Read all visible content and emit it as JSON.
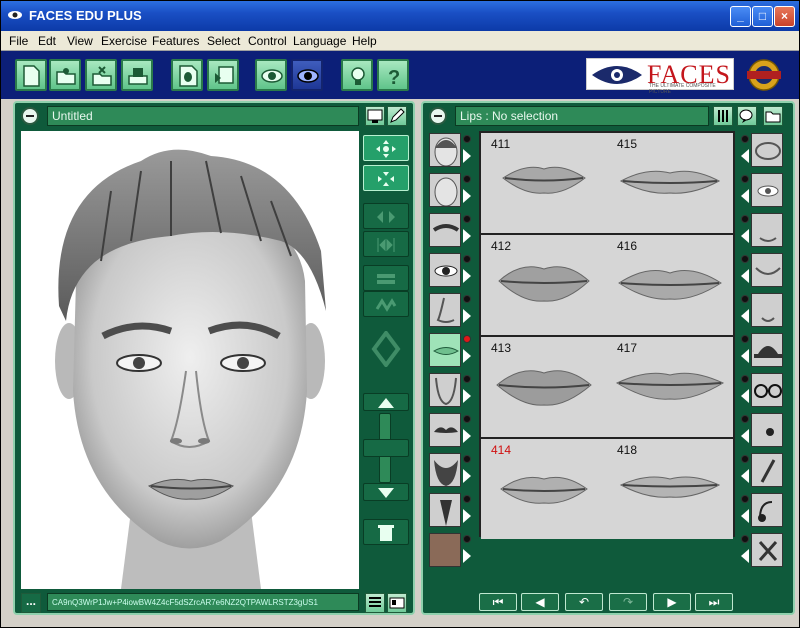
{
  "window": {
    "title": "FACES EDU PLUS",
    "controls": {
      "minimize": "_",
      "maximize": "□",
      "close": "×"
    }
  },
  "menu": [
    "File",
    "Edt",
    "View",
    "Exercise",
    "Features",
    "Select",
    "Control",
    "Language",
    "Help"
  ],
  "toolbar": {
    "buttons": [
      "new-document-icon",
      "open-folder-icon",
      "save-folder-icon",
      "print-icon",
      "face-export-icon",
      "slideshow-icon",
      "eye-icon",
      "dark-eye-icon",
      "hint-bulb-icon",
      "help-icon"
    ]
  },
  "logo": {
    "text": "FACES",
    "tagline": "THE ULTIMATE COMPOSITE PICTURE"
  },
  "left_panel": {
    "title": "Untitled",
    "code": "CA9nQ3WrP1Jw+P4iowBW4Z4cF5dSZrcAR7e6NZ2QTPAWLRSTZ3gUS1",
    "more_label": "..."
  },
  "right_panel": {
    "title": "Lips : No selection",
    "cells": [
      {
        "id": "411",
        "selected": false
      },
      {
        "id": "415",
        "selected": false
      },
      {
        "id": "412",
        "selected": false
      },
      {
        "id": "416",
        "selected": false
      },
      {
        "id": "413",
        "selected": false
      },
      {
        "id": "417",
        "selected": false
      },
      {
        "id": "414",
        "selected": true
      },
      {
        "id": "418",
        "selected": false
      }
    ],
    "left_features": [
      "head-shape",
      "head-shape-2",
      "eyebrows",
      "eyes",
      "nose",
      "lips",
      "chin",
      "moustache",
      "beard",
      "goatee",
      "skin-color"
    ],
    "right_features": [
      "ears",
      "eye-lines",
      "nose-lines",
      "mouth-lines",
      "chin-lines",
      "hat",
      "glasses",
      "mole",
      "scar",
      "headset",
      "accessory"
    ],
    "selected_feature": "lips",
    "nav": [
      "⏮",
      "◀",
      "↶",
      "↷",
      "▶",
      "⏭"
    ]
  },
  "colors": {
    "panel": "#0f5a3b",
    "panel_border": "#8fd1ad",
    "toolbar": "#0c1f78",
    "selected_number": "#d01010"
  }
}
